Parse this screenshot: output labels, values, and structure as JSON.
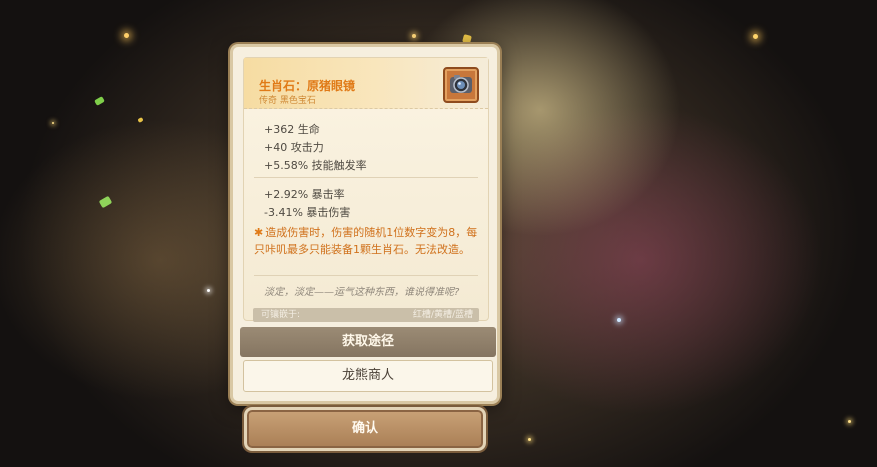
{
  "item": {
    "name": "生肖石：原猪眼镜",
    "subtitle": "传奇 黑色宝石",
    "icon": "camera-lens-gem-icon"
  },
  "base_stats": [
    "+362 生命",
    "+40 攻击力",
    "+5.58% 技能触发率"
  ],
  "extra_stats": [
    "+2.92% 暴击率",
    "-3.41% 暴击伤害"
  ],
  "effect": {
    "bullet": "✱",
    "text": "造成伤害时，伤害的随机1位数字变为8，每只咔叽最多只能装备1颗生肖石。无法改造。"
  },
  "flavor_text": "淡定，淡定——运气这种东西，谁说得准呢?",
  "socket": {
    "label": "可镶嵌于:",
    "value": "红槽/黄槽/蓝槽"
  },
  "acquire": {
    "header": "获取途径",
    "source": "龙熊商人"
  },
  "confirm_label": "确认",
  "colors": {
    "title_orange": "#e07a17",
    "effect_orange": "#d0711c",
    "panel_bg": "#f6efdf",
    "header_bar": "#857561"
  }
}
